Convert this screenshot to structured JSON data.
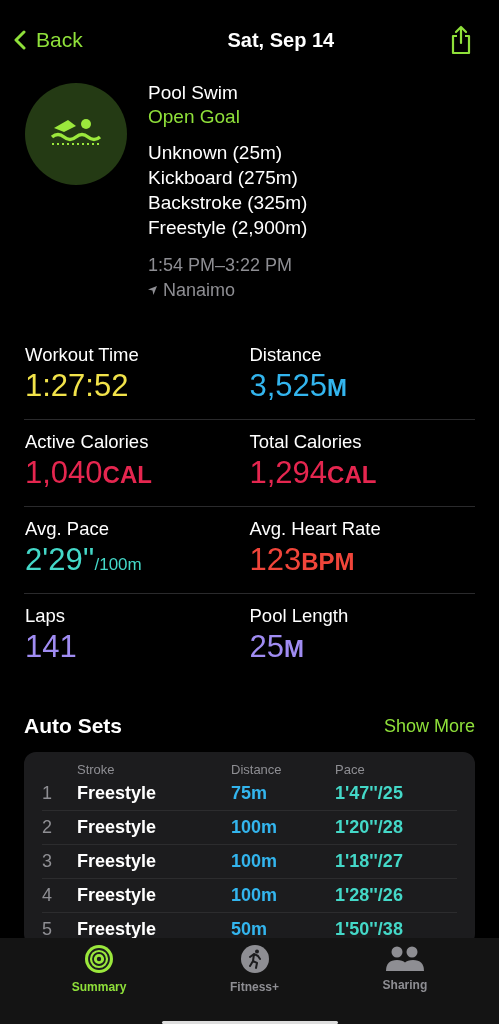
{
  "nav": {
    "back": "Back",
    "title": "Sat, Sep 14"
  },
  "workout": {
    "name": "Pool Swim",
    "goal": "Open Goal",
    "strokes": [
      "Unknown (25m)",
      "Kickboard (275m)",
      "Backstroke (325m)",
      "Freestyle (2,900m)"
    ],
    "time_range": "1:54 PM–3:22 PM",
    "location": "Nanaimo"
  },
  "metrics": [
    {
      "label": "Workout Time",
      "value": "1:27:52",
      "color": "#f2e34a"
    },
    {
      "label": "Distance",
      "value": "3,525",
      "unit": "M",
      "color": "#33b5ee"
    },
    {
      "label": "Active Calories",
      "value": "1,040",
      "unit": "CAL",
      "color": "#e5264f"
    },
    {
      "label": "Total Calories",
      "value": "1,294",
      "unit": "CAL",
      "color": "#e5264f"
    },
    {
      "label": "Avg. Pace",
      "value": "2'29''",
      "unit": "/100m",
      "color": "#44d8c8"
    },
    {
      "label": "Avg. Heart Rate",
      "value": "123",
      "unit": "BPM",
      "color": "#f0453a"
    },
    {
      "label": "Laps",
      "value": "141",
      "color": "#a08cf2"
    },
    {
      "label": "Pool Length",
      "value": "25",
      "unit": "M",
      "color": "#a08cf2"
    }
  ],
  "auto_sets": {
    "title": "Auto Sets",
    "show_more": "Show More",
    "columns": [
      "Stroke",
      "Distance",
      "Pace"
    ],
    "rows": [
      {
        "index": "1",
        "stroke": "Freestyle",
        "distance": "75m",
        "pace": "1'47''/25"
      },
      {
        "index": "2",
        "stroke": "Freestyle",
        "distance": "100m",
        "pace": "1'20''/28"
      },
      {
        "index": "3",
        "stroke": "Freestyle",
        "distance": "100m",
        "pace": "1'18''/27"
      },
      {
        "index": "4",
        "stroke": "Freestyle",
        "distance": "100m",
        "pace": "1'28''/26"
      },
      {
        "index": "5",
        "stroke": "Freestyle",
        "distance": "50m",
        "pace": "1'50''/38"
      }
    ]
  },
  "tab_bar": [
    {
      "label": "Summary",
      "kind": "rings",
      "selected": true
    },
    {
      "label": "Fitness+",
      "kind": "runner",
      "selected": false
    },
    {
      "label": "Sharing",
      "kind": "people",
      "selected": false
    }
  ]
}
